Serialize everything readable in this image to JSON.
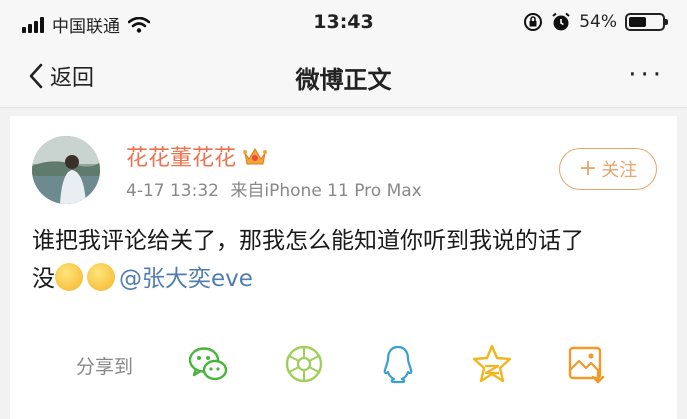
{
  "status_bar": {
    "carrier": "中国联通",
    "time": "13:43",
    "battery_percent": "54%",
    "battery_level": 0.54,
    "icons": [
      "signal-icon",
      "wifi-icon",
      "rotation-lock-icon",
      "alarm-icon",
      "battery-icon"
    ]
  },
  "nav": {
    "back_label": "返回",
    "title": "微博正文",
    "more_label": "···"
  },
  "post": {
    "username": "花花董花花",
    "timestamp": "4-17 13:32",
    "source": "来自iPhone 11 Pro Max",
    "follow_label": "关注",
    "follow_plus": "+",
    "text_line1": "谁把我评论给关了，那我怎么能知道你听到我说的话了",
    "text_line2": "没",
    "mention": "@张大奕eve"
  },
  "share": {
    "label": "分享到",
    "targets": [
      "wechat-icon",
      "moments-icon",
      "qq-icon",
      "qzone-icon",
      "save-image-icon"
    ]
  },
  "colors": {
    "username": "#eb7350",
    "follow": "#e9a66d",
    "mention": "#507daf",
    "share_wechat": "#47b53a",
    "share_moments": "#9fcf5a",
    "share_qq": "#3a9fd8",
    "share_qzone": "#f2b51d",
    "share_save": "#f09a2a"
  }
}
